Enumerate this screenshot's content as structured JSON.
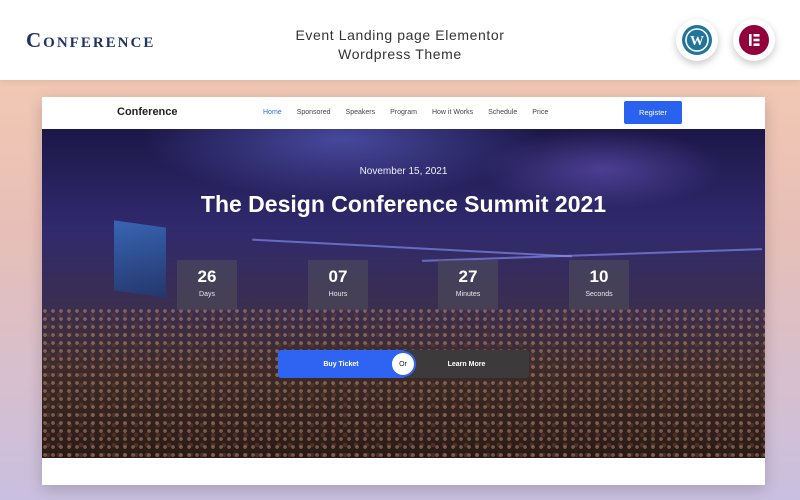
{
  "header": {
    "brand": "Conference",
    "promo_title_line1": "Event Landing page Elementor",
    "promo_title_line2": "Wordpress Theme",
    "badges": [
      {
        "icon": "wordpress-icon",
        "color": "#21759b"
      },
      {
        "icon": "elementor-icon",
        "color": "#92003b"
      }
    ]
  },
  "site": {
    "logo": "Conference",
    "nav": [
      "Home",
      "Sponsored",
      "Speakers",
      "Program",
      "How it Works",
      "Schedule",
      "Price"
    ],
    "active_nav": "Home",
    "register_label": "Register",
    "accent": "#2a62f0"
  },
  "hero": {
    "date": "November 15, 2021",
    "title": "The Design Conference Summit 2021",
    "countdown": [
      {
        "value": "26",
        "label": "Days"
      },
      {
        "value": "07",
        "label": "Hours"
      },
      {
        "value": "27",
        "label": "Minutes"
      },
      {
        "value": "10",
        "label": "Seconds"
      }
    ],
    "buy_label": "Buy Ticket",
    "or_label": "Or",
    "learn_label": "Learn More"
  }
}
